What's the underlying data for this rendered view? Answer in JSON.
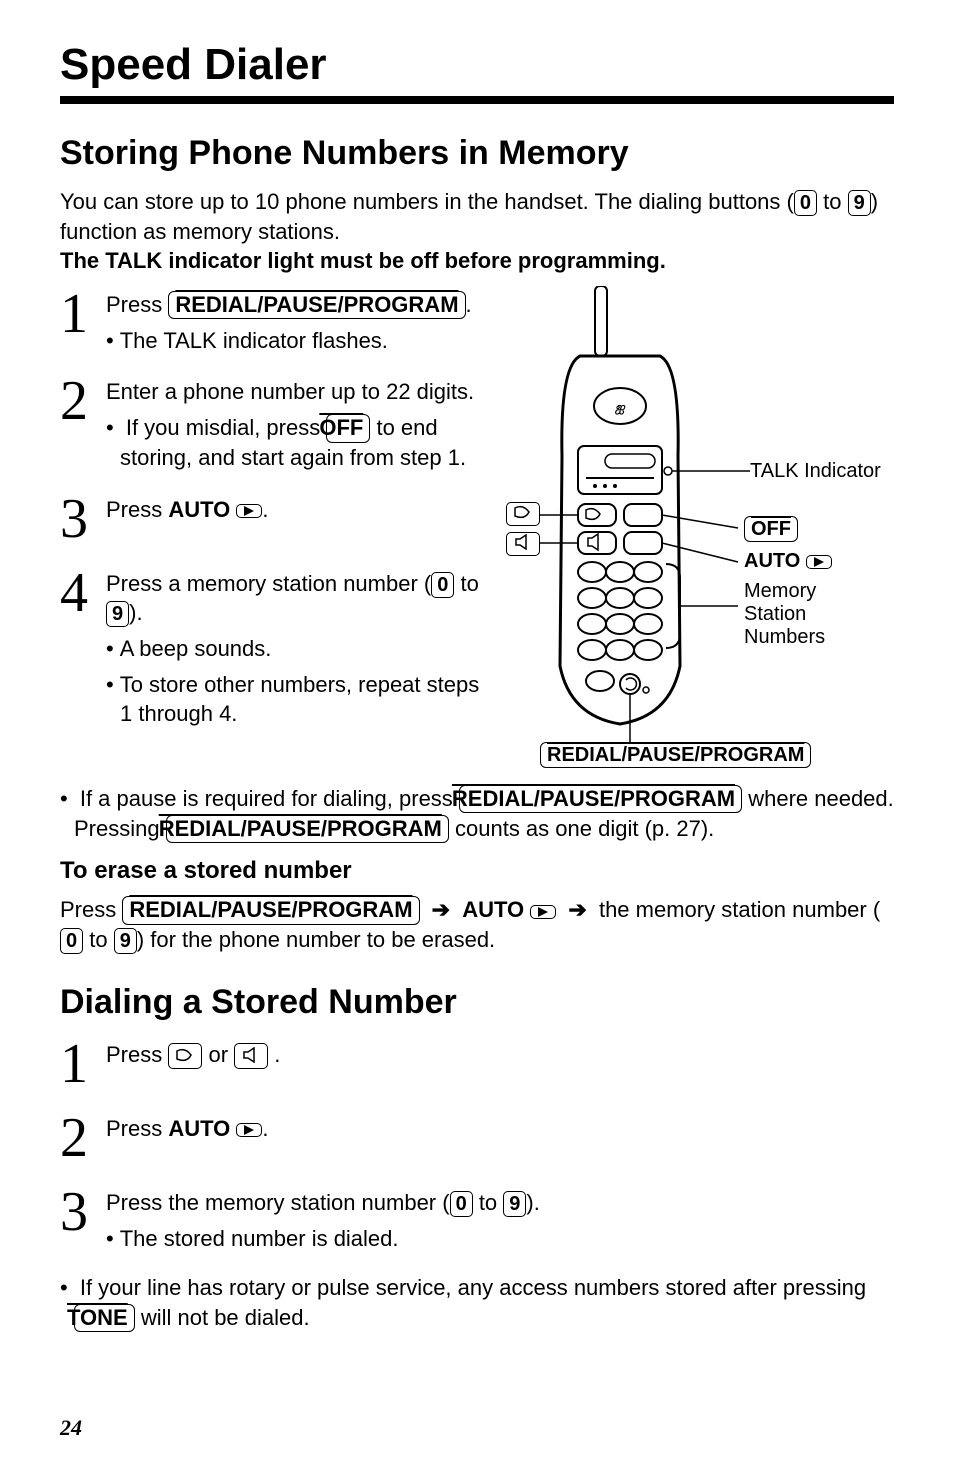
{
  "title": "Speed Dialer",
  "section1": {
    "heading": "Storing Phone Numbers in Memory",
    "intro_line1": "You can store up to 10 phone numbers in the handset. The dialing buttons (",
    "intro_digit0": "0",
    "intro_to": " to ",
    "intro_digit9": "9",
    "intro_line1_end": ") function as memory stations.",
    "intro_bold": "The TALK indicator light must be off before programming.",
    "steps": {
      "s1_num": "1",
      "s1_text_a": "Press ",
      "s1_key": "REDIAL/PAUSE/PROGRAM",
      "s1_text_b": ".",
      "s1_sub1": "The TALK indicator flashes.",
      "s2_num": "2",
      "s2_text": "Enter a phone number up to 22 digits.",
      "s2_sub1_a": "If you misdial, press ",
      "s2_sub1_key": "OFF",
      "s2_sub1_b": " to end storing, and start again from step 1.",
      "s3_num": "3",
      "s3_text_a": "Press ",
      "s3_text_bold": "AUTO",
      "s3_text_b": ".",
      "s4_num": "4",
      "s4_text_a": "Press a memory station number (",
      "s4_digit0": "0",
      "s4_to": " to ",
      "s4_digit9": "9",
      "s4_text_b": ").",
      "s4_sub1": "A beep sounds.",
      "s4_sub2": "To store other numbers, repeat steps 1 through 4."
    },
    "diagram": {
      "talk_indicator": "TALK Indicator",
      "off": "OFF",
      "auto_label": "AUTO",
      "memory_label": "Memory\nStation\nNumbers",
      "redial": "REDIAL/PAUSE/PROGRAM"
    },
    "note_a": "If a pause is required for dialing, press ",
    "note_key1": "REDIAL/PAUSE/PROGRAM",
    "note_b": " where needed. Pressing ",
    "note_key2": "REDIAL/PAUSE/PROGRAM",
    "note_c": " counts as one digit (p. 27).",
    "erase": {
      "heading": "To erase a stored number",
      "text_a": "Press ",
      "key1": "REDIAL/PAUSE/PROGRAM",
      "text_b": " ",
      "arrow1": "➔",
      "text_c": " ",
      "auto": "AUTO",
      "text_d": " ",
      "arrow2": "➔",
      "text_e": " the memory station number (",
      "digit0": "0",
      "to": " to ",
      "digit9": "9",
      "text_f": ") for the phone number to be erased."
    }
  },
  "section2": {
    "heading": "Dialing a Stored Number",
    "s1_num": "1",
    "s1_text_a": "Press ",
    "s1_text_b": " or ",
    "s1_text_c": " .",
    "s2_num": "2",
    "s2_text_a": "Press ",
    "s2_text_bold": "AUTO",
    "s2_text_b": ".",
    "s3_num": "3",
    "s3_text_a": "Press the memory station number (",
    "s3_digit0": "0",
    "s3_to": " to ",
    "s3_digit9": "9",
    "s3_text_b": ").",
    "s3_sub1": "The stored number is dialed.",
    "note_a": "If your line has rotary or pulse service, any access numbers stored after pressing ",
    "note_key": "TONE",
    "note_b": " will not be dialed."
  },
  "pageno": "24"
}
